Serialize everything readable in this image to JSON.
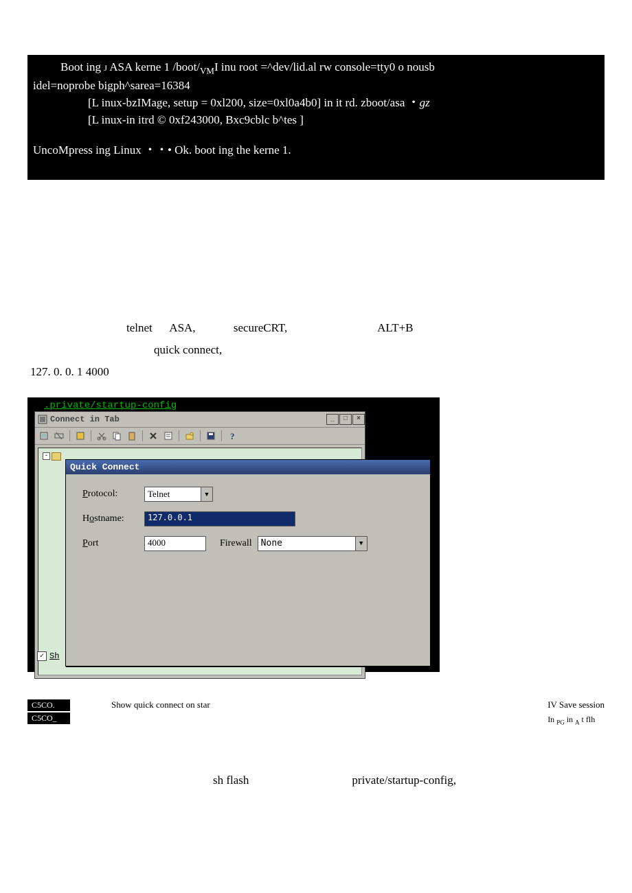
{
  "terminal": {
    "line1_a": "Boot ing ",
    "line1_b": " ASA kerne 1 /boot/",
    "line1_vm": "VM",
    "line1_c": "I inu    root =^dev/lid.al rw console=tty0 o nousb",
    "line1cont": "idel=noprobe bigph^sarea=16384",
    "line2_a": "[L inux-bzIMage, setup = 0xl200, size=0xl0a4b0] in it rd. zboot/asa ",
    "line2_dot": "・",
    "line2_gz": "gz",
    "line3": "[L inux-in itrd © 0xf243000, Bxc9cblc b^tes ]",
    "line4": "UncoMpress ing Linux ・・• Ok. boot ing the kerne 1.",
    "small_j": "J"
  },
  "body": {
    "row1_a": "telnet",
    "row1_b": "ASA,",
    "row1_c": "secureCRT,",
    "row1_d": "ALT+B",
    "row2": "quick connect,",
    "row3": "127. 0. 0. 1 4000"
  },
  "crt": {
    "path": ".private/startup-config",
    "tab_title": "Connect in Tab",
    "qc_title": "Quick Connect",
    "protocol_label_u": "P",
    "protocol_label_rest": "rotocol:",
    "protocol_value": "Telnet",
    "hostname_label_pre": "H",
    "hostname_label_u": "o",
    "hostname_label_rest": "stname:",
    "hostname_value": "127.0.0.1",
    "port_label_u": "P",
    "port_label_rest": "ort",
    "port_value": "4000",
    "firewall_label_u": "F",
    "firewall_label_rest": "irewall",
    "firewall_value": "None",
    "sh_label": "Sh"
  },
  "below": {
    "csco1": "C5CO.",
    "csco2": "C5CO_",
    "show_quick": "Show quick connect on star",
    "save_session": "IV Save session",
    "in_pg_a": "In ",
    "in_pg_pg": "PG",
    "in_pg_b": " in ",
    "in_pg_A": "A",
    "in_pg_c": " t flh"
  },
  "final": {
    "a": "sh flash",
    "b": "private/startup-config,"
  }
}
